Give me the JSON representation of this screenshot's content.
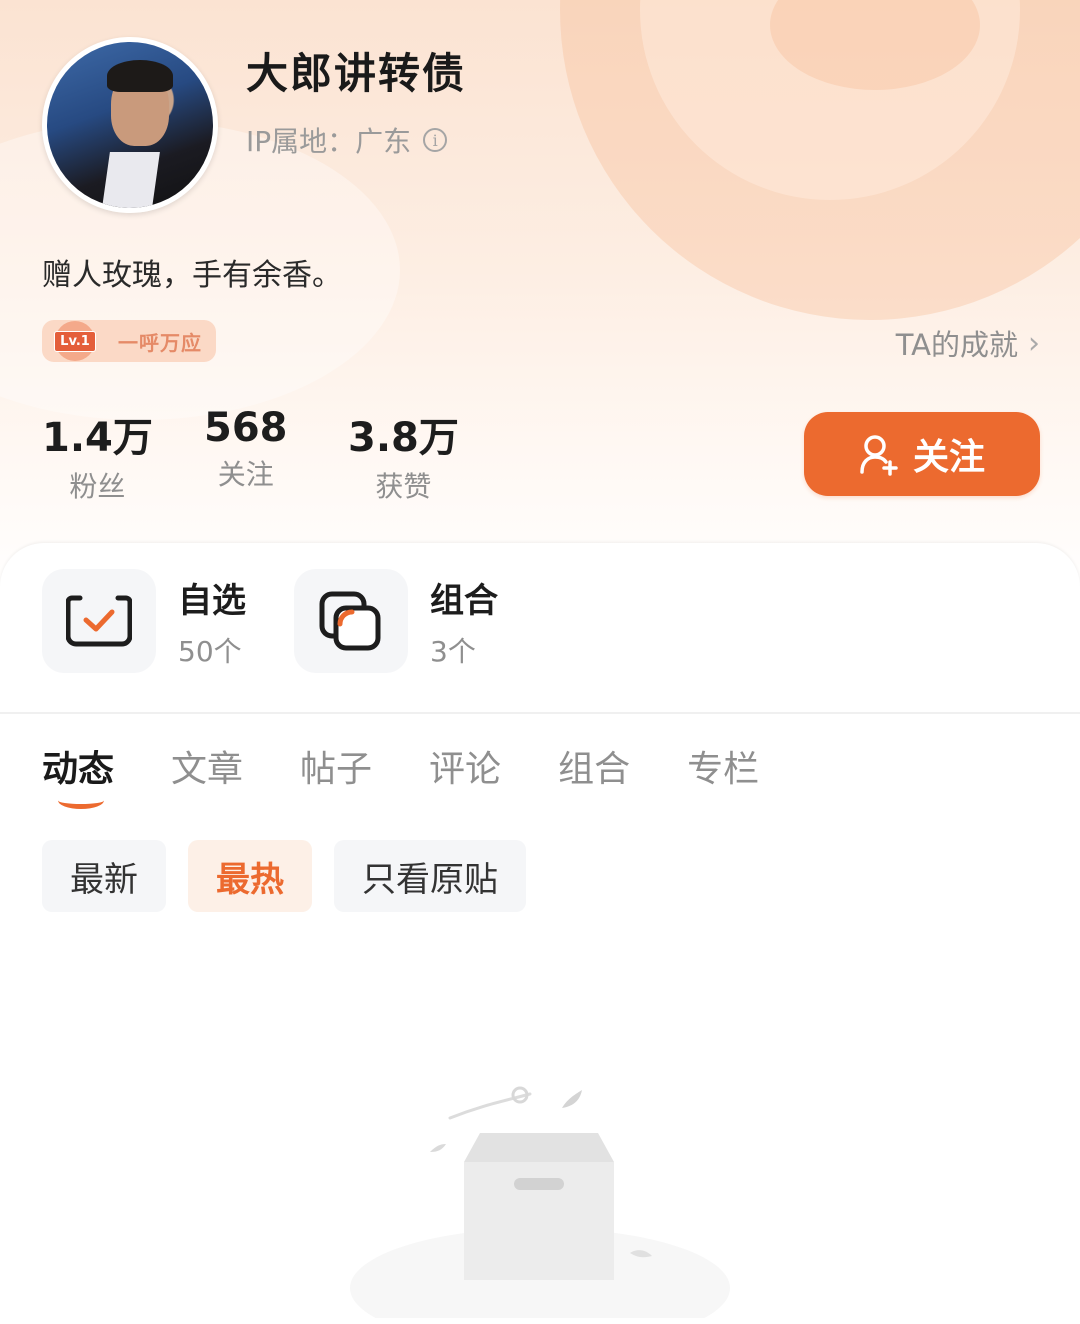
{
  "profile": {
    "username": "大郎讲转债",
    "ip_location": "IP属地：广东",
    "bio": "赠人玫瑰，手有余香。",
    "level": {
      "tag": "Lv.1",
      "name": "一呼万应"
    },
    "achievements_link": "TA的成就"
  },
  "stats": [
    {
      "value": "1.4万",
      "label": "粉丝"
    },
    {
      "value": "568",
      "label": "关注"
    },
    {
      "value": "3.8万",
      "label": "获赞"
    }
  ],
  "follow_button": "关注",
  "shortcuts": [
    {
      "title": "自选",
      "count": "50个",
      "icon": "checklist-icon"
    },
    {
      "title": "组合",
      "count": "3个",
      "icon": "portfolio-icon"
    }
  ],
  "tabs": [
    "动态",
    "文章",
    "帖子",
    "评论",
    "组合",
    "专栏"
  ],
  "active_tab": "动态",
  "filters": [
    "最新",
    "最热",
    "只看原贴"
  ],
  "active_filter": "最热",
  "colors": {
    "accent": "#ec6a2f",
    "header_bg": "#fbe3d2"
  }
}
